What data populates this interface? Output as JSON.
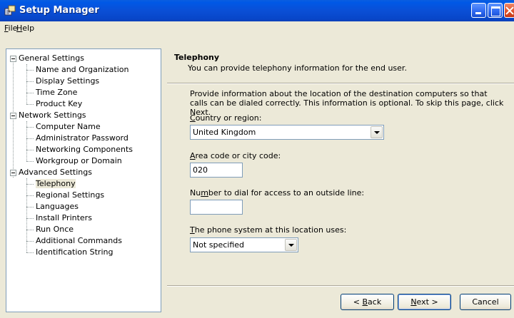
{
  "window": {
    "title": "Setup Manager"
  },
  "menu": [
    {
      "label": "File",
      "accel": "F",
      "rest": "ile"
    },
    {
      "label": "Help",
      "accel": "H",
      "rest": "elp"
    }
  ],
  "tree": {
    "groups": [
      {
        "label": "General Settings",
        "items": [
          "Name and Organization",
          "Display Settings",
          "Time Zone",
          "Product Key"
        ]
      },
      {
        "label": "Network Settings",
        "items": [
          "Computer Name",
          "Administrator Password",
          "Networking Components",
          "Workgroup or Domain"
        ]
      },
      {
        "label": "Advanced Settings",
        "items": [
          "Telephony",
          "Regional Settings",
          "Languages",
          "Install Printers",
          "Run Once",
          "Additional Commands",
          "Identification String"
        ]
      }
    ],
    "selected": "Telephony"
  },
  "page": {
    "title": "Telephony",
    "description": "You can provide telephony information for the end user.",
    "intro": "Provide information about the location of the destination computers so that calls can be dialed correctly. This information is optional. To skip this page, click Next."
  },
  "fields": {
    "country": {
      "accel": "C",
      "rest": "ountry or region:",
      "value": "United Kingdom"
    },
    "area_code": {
      "accel": "A",
      "rest": "rea code or city code:",
      "value": "020"
    },
    "outside_line": {
      "pre": "Nu",
      "accel": "m",
      "rest": "ber to dial for access to an outside line:",
      "value": ""
    },
    "phone_system": {
      "accel": "T",
      "rest": "he phone system at this location uses:",
      "value": "Not specified"
    }
  },
  "buttons": {
    "back": {
      "pre": "< ",
      "accel": "B",
      "rest": "ack"
    },
    "next": {
      "pre": "",
      "accel": "N",
      "rest": "ext >"
    },
    "cancel": "Cancel"
  }
}
